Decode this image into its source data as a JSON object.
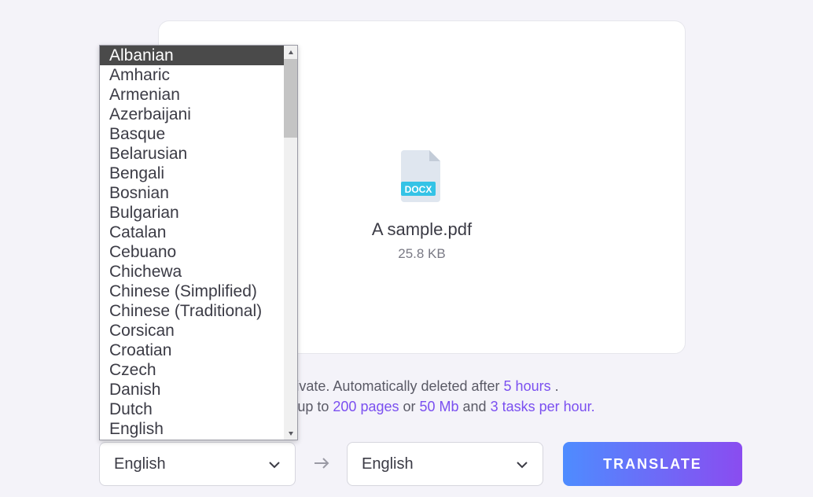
{
  "file": {
    "name": "A sample.pdf",
    "size": "25.8 KB",
    "badge": "DOCX"
  },
  "info": {
    "line1_prefix": "private. Automatically deleted after ",
    "line1_highlight": "5 hours",
    "line1_suffix": " .",
    "line2_prefix": "uments up to ",
    "line2_h1": "200 pages",
    "line2_mid1": " or ",
    "line2_h2": "50 Mb",
    "line2_mid2": " and ",
    "line2_h3": "3 tasks per hour."
  },
  "source_lang": "English",
  "target_lang": "English",
  "translate_label": "TRANSLATE",
  "dropdown": {
    "selected_index": 0,
    "items": [
      "Albanian",
      "Amharic",
      "Armenian",
      "Azerbaijani",
      "Basque",
      "Belarusian",
      "Bengali",
      "Bosnian",
      "Bulgarian",
      "Catalan",
      "Cebuano",
      "Chichewa",
      "Chinese (Simplified)",
      "Chinese (Traditional)",
      "Corsican",
      "Croatian",
      "Czech",
      "Danish",
      "Dutch",
      "English"
    ]
  }
}
